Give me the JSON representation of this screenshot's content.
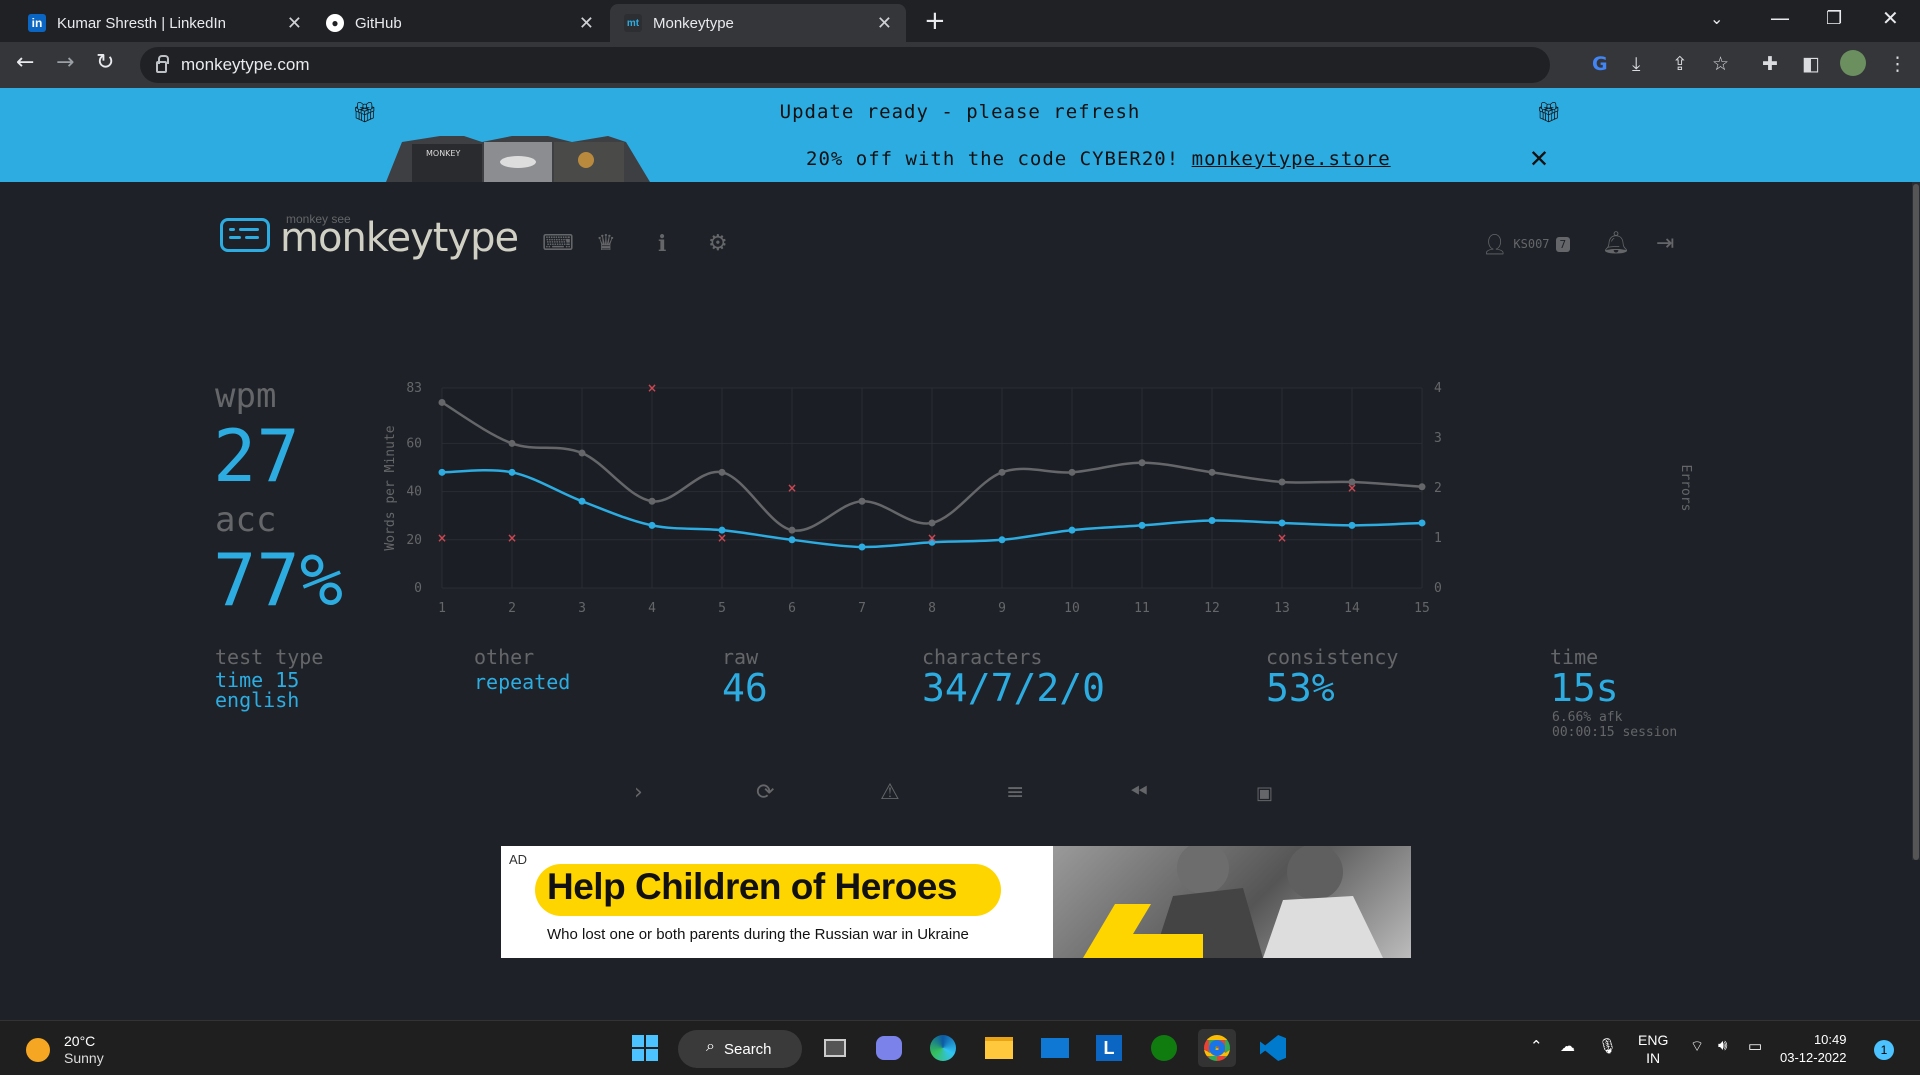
{
  "browser": {
    "tabs": [
      {
        "title": "Kumar Shresth | LinkedIn",
        "favicon": "in"
      },
      {
        "title": "GitHub",
        "favicon": "github"
      },
      {
        "title": "Monkeytype",
        "favicon": "mt"
      }
    ],
    "url": "monkeytype.com"
  },
  "banner": {
    "update_text": "Update ready - please refresh",
    "promo_text": "20% off with the code CYBER20!",
    "store_link": "monkeytype.store"
  },
  "app": {
    "logo_sub": "monkey see",
    "logo_text": "monkeytype",
    "username": "KS007",
    "level": "7"
  },
  "results": {
    "wpm_label": "wpm",
    "wpm": "27",
    "acc_label": "acc",
    "acc": "77%",
    "test_type_label": "test type",
    "test_type_1": "time 15",
    "test_type_2": "english",
    "other_label": "other",
    "other_value": "repeated",
    "raw_label": "raw",
    "raw": "46",
    "characters_label": "characters",
    "characters": "34/7/2/0",
    "consistency_label": "consistency",
    "consistency": "53%",
    "time_label": "time",
    "time": "15s",
    "afk": "6.66% afk",
    "session": "00:00:15 session"
  },
  "chart_data": {
    "type": "line",
    "x": [
      1,
      2,
      3,
      4,
      5,
      6,
      7,
      8,
      9,
      10,
      11,
      12,
      13,
      14,
      15
    ],
    "series": [
      {
        "values": [
          48,
          48,
          36,
          26,
          24,
          20,
          17,
          19,
          20,
          24,
          26,
          28,
          27,
          26,
          27
        ]
      },
      {
        "values": [
          77,
          60,
          56,
          36,
          48,
          24,
          36,
          27,
          48,
          48,
          52,
          48,
          44,
          44,
          42
        ]
      }
    ],
    "errors": [
      {
        "x": 1,
        "value": 1
      },
      {
        "x": 2,
        "value": 1
      },
      {
        "x": 4,
        "value": 4
      },
      {
        "x": 5,
        "value": 1
      },
      {
        "x": 6,
        "value": 2
      },
      {
        "x": 8,
        "value": 1
      },
      {
        "x": 13,
        "value": 1
      },
      {
        "x": 14,
        "value": 2
      }
    ],
    "ylabel": "Words per Minute",
    "y2label": "Errors",
    "ylim": [
      0,
      83
    ],
    "y2lim": [
      0,
      4
    ],
    "yticks": [
      "0",
      "20",
      "40",
      "60",
      "83"
    ],
    "y2ticks": [
      "0",
      "1",
      "2",
      "3",
      "4"
    ],
    "xticks": [
      "1",
      "2",
      "3",
      "4",
      "5",
      "6",
      "7",
      "8",
      "9",
      "10",
      "11",
      "12",
      "13",
      "14",
      "15"
    ],
    "grid": true,
    "colors": {
      "wpm": "#2dace1",
      "raw": "#646669",
      "errors": "#ca4754"
    }
  },
  "ad": {
    "tag": "AD",
    "headline": "Help Children of Heroes",
    "subline": "Who lost one or both parents during the Russian war in Ukraine"
  },
  "taskbar": {
    "temp": "20°C",
    "weather": "Sunny",
    "search": "Search",
    "lang1": "ENG",
    "lang2": "IN",
    "time": "10:49",
    "date": "03-12-2022",
    "notifications": "1"
  },
  "colors": {
    "accent": "#2dace1",
    "background": "#1e2127",
    "sub": "#646669",
    "banner": "#2dace1"
  }
}
